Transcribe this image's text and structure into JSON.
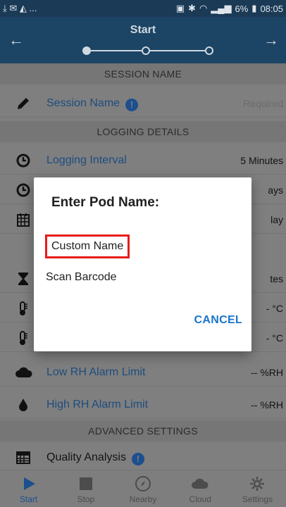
{
  "status_bar": {
    "left_icons": "⤓ ✉ ◭ ...",
    "battery": "6%",
    "time": "08:05"
  },
  "app_bar": {
    "title": "Start",
    "back_icon": "←",
    "forward_icon": "→",
    "steps": 3,
    "current_step": 1
  },
  "sections": {
    "session_name": "SESSION NAME",
    "logging_details": "LOGGING DETAILS",
    "advanced_settings": "ADVANCED SETTINGS"
  },
  "rows": {
    "session_name": {
      "label": "Session Name",
      "value": "Required"
    },
    "logging_interval": {
      "label": "Logging Interval",
      "value": "5 Minutes"
    },
    "row_duration": {
      "value": "ays"
    },
    "row_start": {
      "value": "lay"
    },
    "row_hourglass": {
      "value": "tes"
    },
    "row_temp_low": {
      "value": "- °C"
    },
    "row_temp_high": {
      "value": "- °C"
    },
    "low_rh": {
      "label": "Low RH Alarm Limit",
      "value": "-- %RH"
    },
    "high_rh": {
      "label": "High RH Alarm Limit",
      "value": "-- %RH"
    },
    "quality_analysis": {
      "label": "Quality Analysis"
    }
  },
  "dialog": {
    "title": "Enter Pod Name:",
    "option_custom": "Custom Name",
    "option_barcode": "Scan Barcode",
    "cancel": "CANCEL"
  },
  "bottom_nav": [
    {
      "label": "Start",
      "icon": "play-icon",
      "active": true
    },
    {
      "label": "Stop",
      "icon": "stop-icon",
      "active": false
    },
    {
      "label": "Nearby",
      "icon": "compass-icon",
      "active": false
    },
    {
      "label": "Cloud",
      "icon": "cloud-icon",
      "active": false
    },
    {
      "label": "Settings",
      "icon": "gear-icon",
      "active": false
    }
  ],
  "colors": {
    "app_bar": "#1c4464",
    "accent": "#1a75c8",
    "highlight_box": "#e81b1b",
    "label_blue": "#1d4d7e"
  }
}
